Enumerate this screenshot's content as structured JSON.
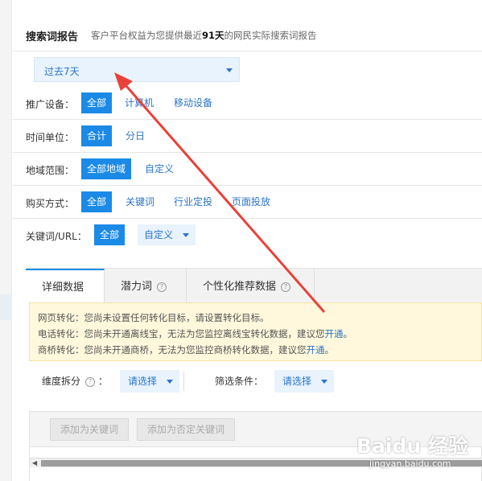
{
  "header": {
    "title": "搜索词报告",
    "desc_prefix": "客户平台权益为您提供最近",
    "desc_days": "91天",
    "desc_suffix": "的网民实际搜索词报告"
  },
  "date_range": {
    "value": "过去7天"
  },
  "filters": {
    "device": {
      "label": "推广设备：",
      "options": [
        "全部",
        "计算机",
        "移动设备"
      ]
    },
    "time_unit": {
      "label": "时间单位：",
      "options": [
        "合计",
        "分日"
      ]
    },
    "region": {
      "label": "地域范围：",
      "options": [
        "全部地域",
        "自定义"
      ]
    },
    "buy_mode": {
      "label": "购买方式：",
      "options": [
        "全部",
        "关键词",
        "行业定投",
        "页面投放"
      ]
    },
    "keyword_url": {
      "label": "关键词/URL：",
      "options": [
        "全部",
        "自定义"
      ]
    }
  },
  "tabs": [
    "详细数据",
    "潜力词",
    "个性化推荐数据"
  ],
  "notice": {
    "line1": "网页转化：您尚未设置任何转化目标，请设置转化目标。",
    "line2_text": "电话转化：您尚未开通离线宝，无法为您监控离线宝转化数据，建议您",
    "line2_link": "开通",
    "line2_end": "。",
    "line3_text": "商桥转化：您尚未开通商桥，无法为您监控商桥转化数据，建议您",
    "line3_link": "开通",
    "line3_end": "。"
  },
  "dimension": {
    "label": "维度拆分",
    "colon": "：",
    "value": "请选择"
  },
  "screen": {
    "label": "筛选条件：",
    "value": "请选择"
  },
  "actions": {
    "add_keyword": "添加为关键词",
    "add_negative": "添加为否定关键词"
  },
  "watermark": {
    "logo": "Baidu 经验",
    "url": "jingyan.baidu.com"
  },
  "colors": {
    "accent": "#1b8ae6",
    "link": "#2a74c9",
    "arrow": "#e8413a",
    "notice_bg": "#fff8dc"
  }
}
